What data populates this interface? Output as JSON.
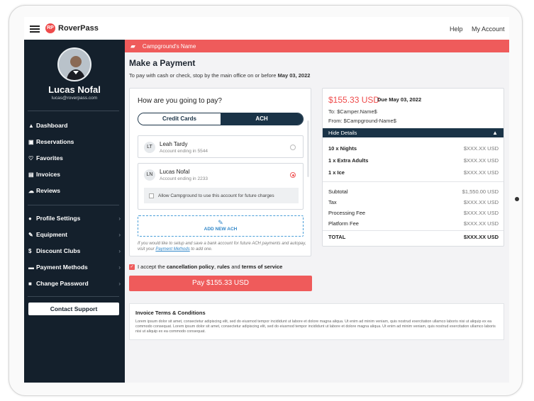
{
  "app": {
    "logo_text": "RoverPass",
    "logo_mark": "RP"
  },
  "topnav": {
    "help": "Help",
    "account": "My Account"
  },
  "user": {
    "name": "Lucas Nofal",
    "email": "lucas@roverpass.com"
  },
  "sidebar": {
    "main": [
      {
        "label": "Dashboard",
        "icon": "dashboard-icon"
      },
      {
        "label": "Reservations",
        "icon": "calendar-icon"
      },
      {
        "label": "Favorites",
        "icon": "heart-icon"
      },
      {
        "label": "Invoices",
        "icon": "invoice-icon"
      },
      {
        "label": "Reviews",
        "icon": "reviews-icon"
      }
    ],
    "settings": [
      {
        "label": "Profile Settings",
        "icon": "user-icon"
      },
      {
        "label": "Equipment",
        "icon": "wrench-icon"
      },
      {
        "label": "Discount Clubs",
        "icon": "dollar-icon"
      },
      {
        "label": "Payment Methods",
        "icon": "card-icon"
      },
      {
        "label": "Change Password",
        "icon": "lock-icon"
      }
    ],
    "support": "Contact Support"
  },
  "banner": {
    "campground": "Campground's Name"
  },
  "page": {
    "title": "Make a Payment",
    "subtitle": "To pay with cash or check, stop by the main office on or before",
    "deadline": "May 03, 2022"
  },
  "payment": {
    "question": "How are you going to pay?",
    "tabs": {
      "credit": "Credit Cards",
      "ach": "ACH"
    },
    "accounts": [
      {
        "initials": "LT",
        "name": "Leah Tardy",
        "ending": "Account ending in 5544",
        "selected": false
      },
      {
        "initials": "LN",
        "name": "Lucas Nofal",
        "ending": "Account ending in 2233",
        "selected": true
      }
    ],
    "allow_text": "Allow Campground to use this account for future charges",
    "add_ach": "ADD NEW ACH",
    "hint_pre": "If you would like to setup and save a bank account for future ACH payments and autopay, visit your",
    "hint_link": "Payment Methods",
    "hint_post": "to add one."
  },
  "accept": {
    "pre": "I accept the",
    "policy": "cancellation policy",
    "sep": ",",
    "rules": "rules",
    "and": "and",
    "terms": "terms of service"
  },
  "pay_button": "Pay $155.33 USD",
  "summary": {
    "total": "$155.33 USD",
    "due": "Due May 03, 2022",
    "to": "To: $Camper.Name$",
    "from": "From: $Campground-Name$",
    "hide_details": "Hide Details",
    "items": [
      {
        "label": "10  x Nights",
        "value": "$XXX.XX USD"
      },
      {
        "label": "1  x Extra Adults",
        "value": "$XXX.XX USD"
      },
      {
        "label": "1  x Ice",
        "value": "$XXX.XX USD"
      }
    ],
    "fees": [
      {
        "label": "Subtotal",
        "value": "$1,550.00 USD"
      },
      {
        "label": "Tax",
        "value": "$XXX.XX USD"
      },
      {
        "label": "Processing Fee",
        "value": "$XXX.XX USD"
      },
      {
        "label": "Platform Fee",
        "value": "$XXX.XX USD"
      }
    ],
    "grand_label": "TOTAL",
    "grand_value": "$XXX.XX USD"
  },
  "terms": {
    "title": "Invoice Terms & Conditions",
    "body": "Lorem ipsum dolor sit amet, consectetur adipiscing elit, sed do eiusmod tempor incididunt ut labore et dolore magna aliqua. Ut enim ad minim veniam, quis nostrud exercitation ullamco laboris nisi ut aliquip ex ea commodo consequat. Lorem ipsum dolor sit amet, consectetur adipiscing elit, sed do eiusmod tempor incididunt ut labore et dolore magna aliqua. Ut enim ad minim veniam, quis nostrud exercitation ullamco laboris nisi ut aliquip ex ea commodo consequat."
  },
  "colors": {
    "brand": "#ef5b5b",
    "navy": "#1a3347",
    "sidebar": "#14202c"
  }
}
